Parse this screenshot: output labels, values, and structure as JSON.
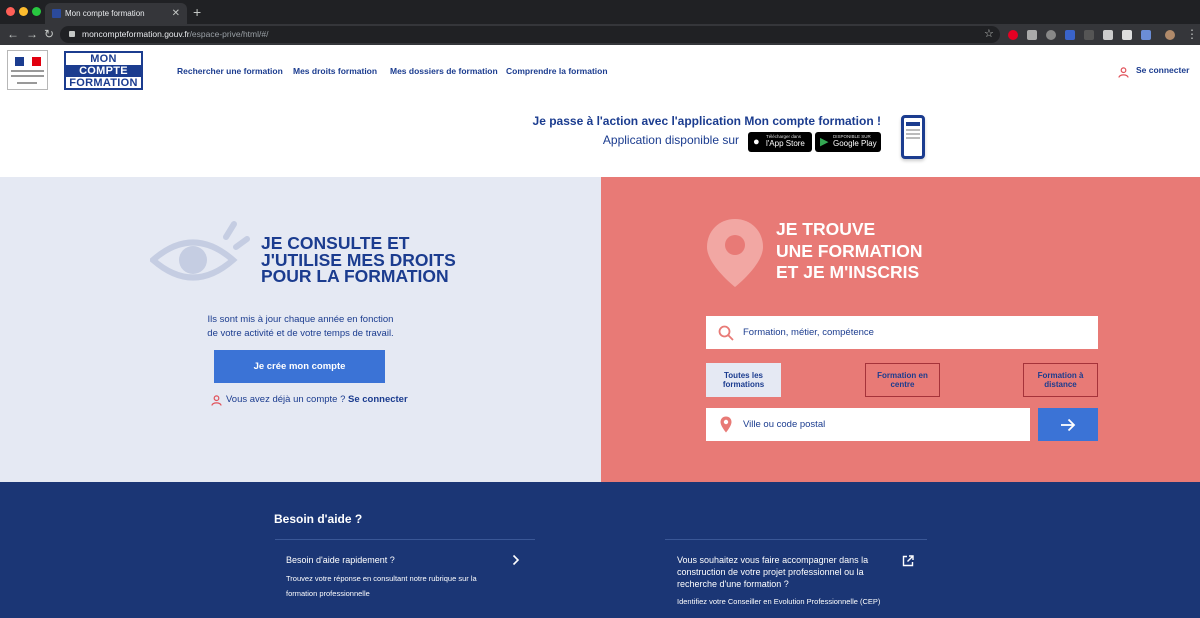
{
  "browser": {
    "tab_title": "Mon compte formation",
    "url_host": "moncompteformation.gouv.fr",
    "url_path": "/espace-prive/html/#/"
  },
  "logo": {
    "line1": "MON",
    "line2": "COMPTE",
    "line3": "FORMATION"
  },
  "nav": {
    "items": [
      "Rechercher une formation",
      "Mes droits formation",
      "Mes dossiers de formation",
      "Comprendre la formation"
    ],
    "login": "Se connecter"
  },
  "banner": {
    "title": "Je passe à l'action avec l'application Mon compte formation !",
    "subtitle": "Application disponible sur",
    "appstore_small": "Télécharger dans",
    "appstore_big": "l'App Store",
    "googleplay_small": "DISPONIBLE SUR",
    "googleplay_big": "Google Play"
  },
  "left": {
    "title": [
      "JE CONSULTE ET",
      "J'UTILISE MES DROITS",
      "POUR LA FORMATION"
    ],
    "desc": [
      "Ils sont mis à jour chaque année en fonction",
      "de votre activité et de votre temps de travail."
    ],
    "create_button": "Je crée mon compte",
    "already": "Vous avez déjà un compte ?",
    "login": "Se connecter"
  },
  "right": {
    "title": [
      "JE TROUVE",
      "UNE FORMATION",
      "ET JE M'INSCRIS"
    ],
    "search_placeholder": "Formation, métier, compétence",
    "filters": [
      [
        "Toutes les",
        "formations"
      ],
      [
        "Formation en",
        "centre"
      ],
      [
        "Formation à",
        "distance"
      ]
    ],
    "city_placeholder": "Ville ou code postal"
  },
  "footer": {
    "title": "Besoin d'aide ?",
    "card1_question": "Besoin d'aide rapidement ?",
    "card1_desc": [
      "Trouvez votre réponse en consultant notre rubrique sur la",
      "formation professionnelle"
    ],
    "card2_question": [
      "Vous souhaitez vous faire accompagner dans la",
      "construction de votre projet professionnel ou la",
      "recherche d'une formation ?"
    ],
    "card2_desc": "Identifiez votre Conseiller en Evolution Professionnelle (CEP)"
  },
  "colors": {
    "navy": "#1b3c8f",
    "left_bg": "#e5e9f3",
    "right_bg": "#e87a76",
    "blue_button": "#3b73d6",
    "footer_bg": "#1b3675"
  }
}
